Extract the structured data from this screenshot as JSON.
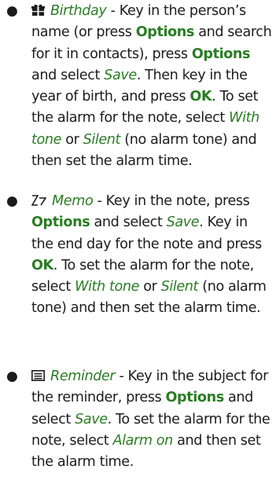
{
  "entries": [
    {
      "icon": "birthday-icon",
      "term": "Birthday",
      "t1": " - Key in the person’s name (or press ",
      "kw1": "Options",
      "t2": " and search for it in contacts), press ",
      "kw2": "Options",
      "t3": " and select ",
      "it1": "Save",
      "t4": ". Then key in the year of birth, and press ",
      "kw3": "OK",
      "t5": ". To set the alarm for the note, select ",
      "it2": "With tone",
      "t6": " or ",
      "it3": "Silent",
      "t7": " (no alarm tone) and then set the alarm time."
    },
    {
      "icon": "memo-icon",
      "term": "Memo",
      "t1": " - Key in the note, press ",
      "kw1": "Options",
      "t2": " and select ",
      "it1": "Save",
      "t3": ". Key in the end day for the note and press ",
      "kw2": "OK",
      "t4": ". To set the alarm for the note, select ",
      "it2": "With tone",
      "t5": " or ",
      "it3": "Silent",
      "t6": " (no alarm tone) and then set the alarm time."
    },
    {
      "icon": "reminder-icon",
      "term": "Reminder",
      "t1": " - Key in the subject for the reminder, press ",
      "kw1": "Options",
      "t2": " and select ",
      "it1": "Save",
      "t3": ". To set the alarm for the note, select ",
      "it2": "Alarm on",
      "t4": " and then set the alarm time."
    }
  ],
  "colors": {
    "emphasis": "#2a7d24",
    "text": "#1c1c1c"
  }
}
